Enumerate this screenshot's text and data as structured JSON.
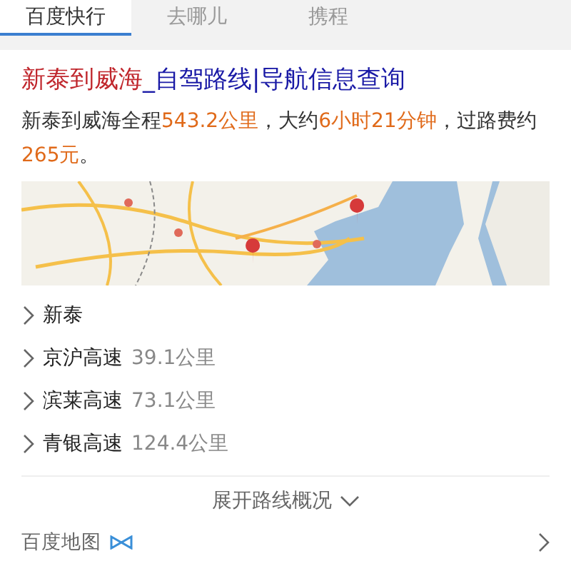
{
  "tabs": [
    {
      "label": "百度快行",
      "selected": true
    },
    {
      "label": "去哪儿",
      "selected": false
    },
    {
      "label": "携程",
      "selected": false
    }
  ],
  "result": {
    "title_highlight": "新泰到威海",
    "title_rest": "_自驾路线|导航信息查询",
    "summary": "新泰到威海全程**543.2公里**，大约**6小时21分钟**，过路费约**265元**。",
    "steps": [
      {
        "road": "新泰"
      },
      {
        "road": "京沪高速",
        "distance": "39.1公里"
      },
      {
        "road": "滨莱高速",
        "distance": "73.1公里"
      },
      {
        "road": "青银高速",
        "distance": "124.4公里"
      }
    ],
    "expand": "展开路线概况",
    "source": "百度地图"
  }
}
